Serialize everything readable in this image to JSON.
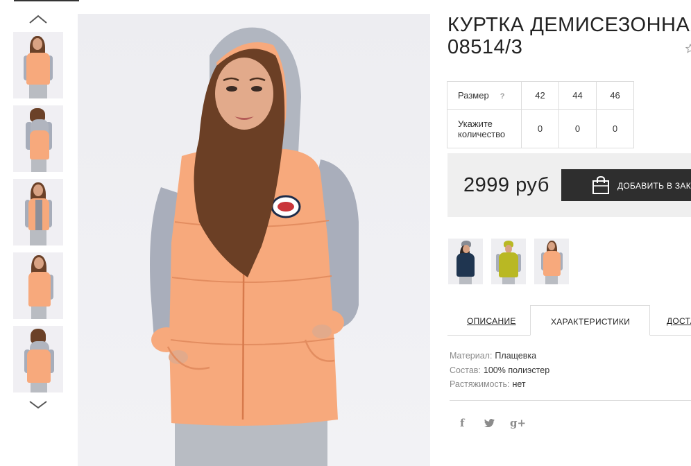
{
  "product": {
    "title_line1": "КУРТКА ДЕМИСЕЗОННАЯ",
    "title_line2": "08514/3"
  },
  "size_table": {
    "size_label": "Размер",
    "help_mark": "?",
    "sizes": [
      "42",
      "44",
      "46"
    ],
    "qty_label_line1": "Укажите",
    "qty_label_line2": "количество",
    "quantities": [
      "0",
      "0",
      "0"
    ]
  },
  "purchase": {
    "price": "2999 руб",
    "add_to_cart_label": "ДОБАВИТЬ В ЗАК"
  },
  "tabs": [
    {
      "label": "ОПИСАНИЕ"
    },
    {
      "label": "ХАРАКТЕРИСТИКИ"
    },
    {
      "label": "ДОСТА"
    }
  ],
  "specs": [
    {
      "key": "Материал:",
      "value": "Плащевка"
    },
    {
      "key": "Состав:",
      "value": "100% полиэстер"
    },
    {
      "key": "Растяжимость:",
      "value": "нет"
    }
  ],
  "social": {
    "facebook": "f",
    "twitter": "t",
    "google_plus": "g+"
  },
  "icons": {
    "gallery_up": "chevron-up-icon",
    "gallery_down": "chevron-down-icon",
    "favorite": "star-icon",
    "cart": "shopping-bag-icon"
  },
  "colors": {
    "jacket_peach": "#f7a97c",
    "sleeve_grey": "#a9aebb",
    "button_dark": "#2e2e2e",
    "price_bg": "#efefef",
    "variant_navy": "#1f3550",
    "variant_olive": "#b9b823"
  }
}
